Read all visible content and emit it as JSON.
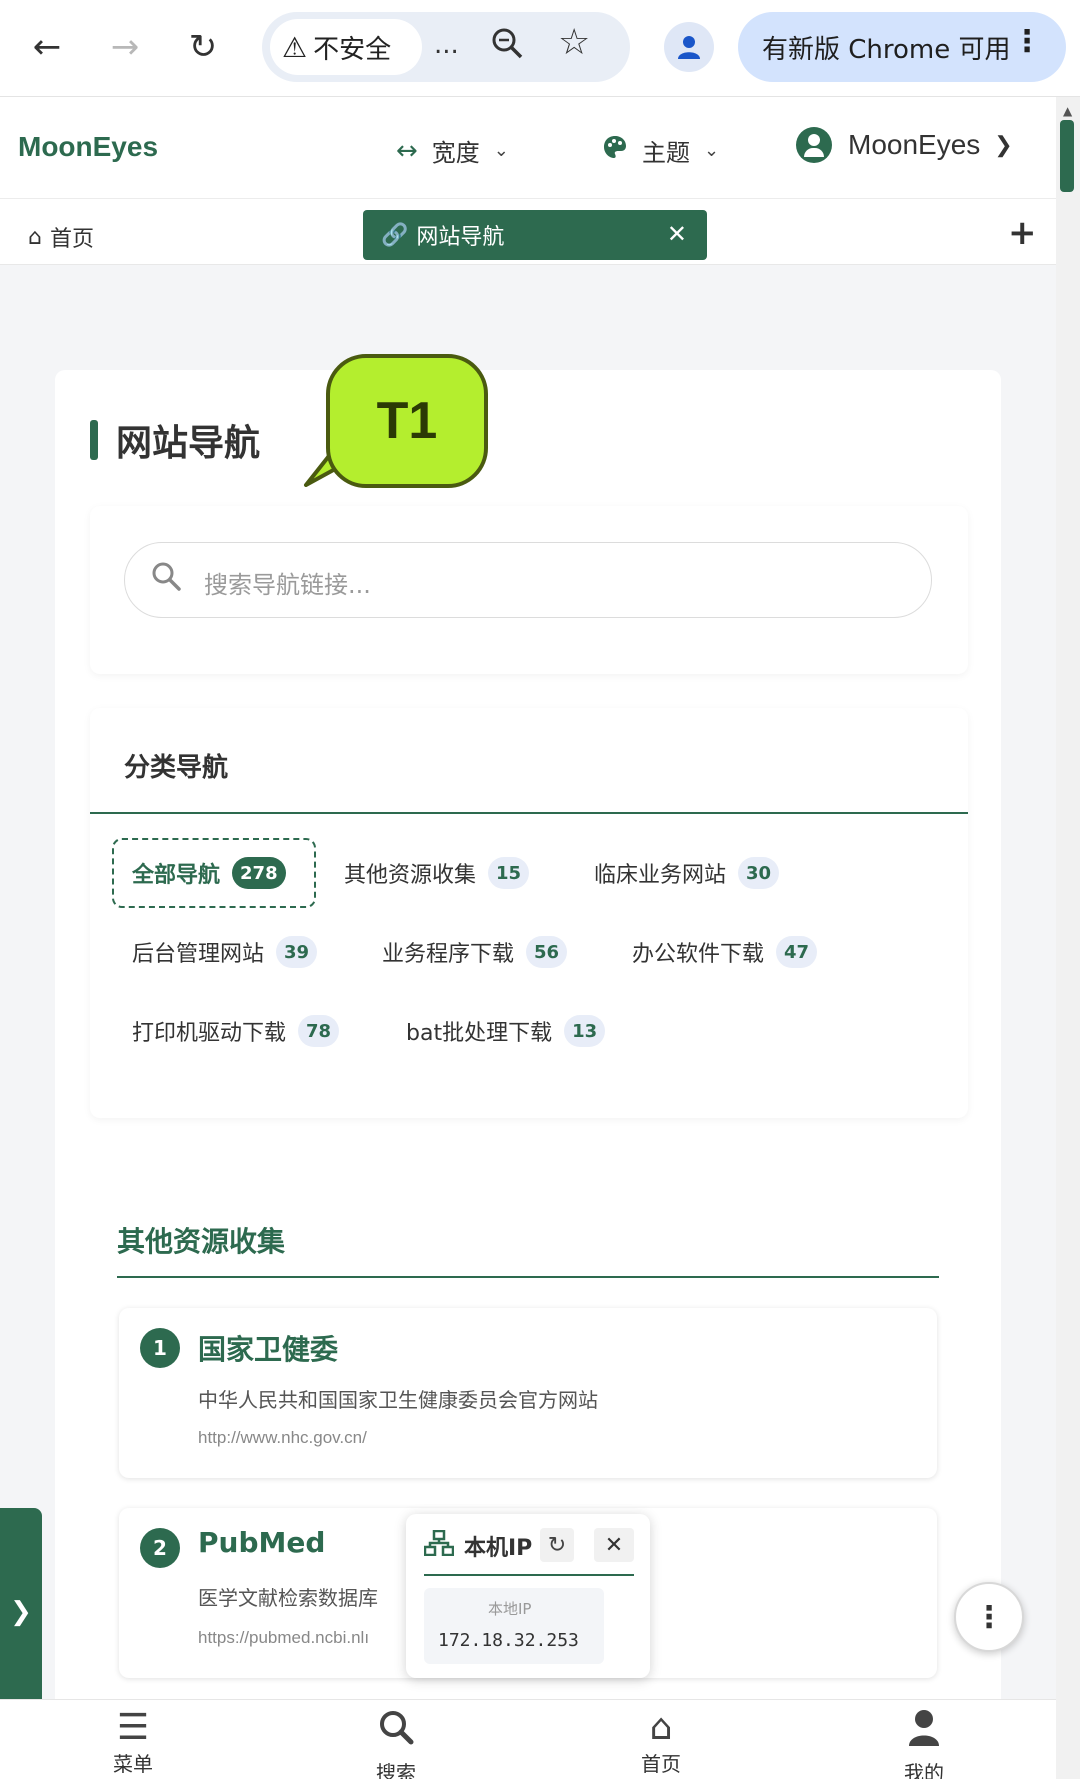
{
  "browser": {
    "security_label": "不安全",
    "more_label": "...",
    "update_label": "有新版 Chrome 可用"
  },
  "header": {
    "brand": "MoonEyes",
    "width_label": "宽度",
    "theme_label": "主题",
    "user_name": "MoonEyes"
  },
  "tabs": {
    "home_label": "首页",
    "active_label": "网站导航"
  },
  "annotation": {
    "bubble_label": "T1"
  },
  "page": {
    "title": "网站导航",
    "search_placeholder": "搜索导航链接..."
  },
  "categories": {
    "title": "分类导航",
    "items": [
      {
        "label": "全部导航",
        "count": "278",
        "active": true
      },
      {
        "label": "其他资源收集",
        "count": "15"
      },
      {
        "label": "临床业务网站",
        "count": "30"
      },
      {
        "label": "后台管理网站",
        "count": "39"
      },
      {
        "label": "业务程序下载",
        "count": "56"
      },
      {
        "label": "办公软件下载",
        "count": "47"
      },
      {
        "label": "打印机驱动下载",
        "count": "78"
      },
      {
        "label": "bat批处理下载",
        "count": "13"
      }
    ]
  },
  "section": {
    "title": "其他资源收集",
    "links": [
      {
        "num": "1",
        "name": "国家卫健委",
        "desc": "中华人民共和国国家卫生健康委员会官方网站",
        "url": "http://www.nhc.gov.cn/"
      },
      {
        "num": "2",
        "name": "PubMed",
        "desc": "医学文献检索数据库",
        "url": "https://pubmed.ncbi.nlı"
      }
    ]
  },
  "ip_popup": {
    "title": "本机IP",
    "label": "本地IP",
    "value": "172.18.32.253"
  },
  "bottom_nav": {
    "menu": "菜单",
    "search": "搜索",
    "home": "首页",
    "mine": "我的"
  },
  "colors": {
    "accent": "#2d6a4f",
    "bubble": "#b4ee2e",
    "chrome_chip": "#d3e3fd"
  }
}
